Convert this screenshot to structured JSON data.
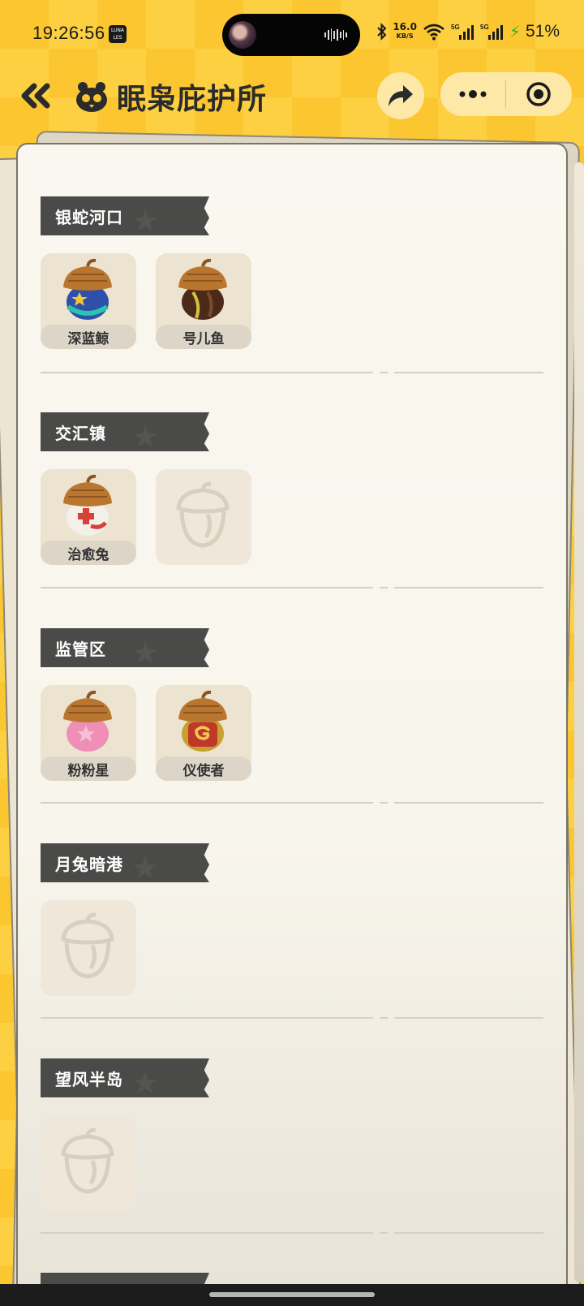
{
  "status_bar": {
    "time": "19:26:56",
    "badge": "LUNA LES",
    "net_speed": "16.0",
    "net_unit": "KB/S",
    "battery": "51%"
  },
  "header": {
    "title": "眠枭庇护所"
  },
  "sections": [
    {
      "title": "银蛇河口",
      "items": [
        {
          "name": "深蓝鲸",
          "icon": "acorn-blue-icon",
          "collected": true
        },
        {
          "name": "号儿鱼",
          "icon": "acorn-brown-icon",
          "collected": true
        }
      ]
    },
    {
      "title": "交汇镇",
      "items": [
        {
          "name": "治愈兔",
          "icon": "acorn-red-cross-icon",
          "collected": true
        },
        {
          "name": "",
          "icon": "acorn-empty-icon",
          "collected": false
        }
      ]
    },
    {
      "title": "监管区",
      "items": [
        {
          "name": "粉粉星",
          "icon": "acorn-pink-icon",
          "collected": true
        },
        {
          "name": "仪使者",
          "icon": "acorn-gold-icon",
          "collected": true
        }
      ]
    },
    {
      "title": "月兔暗港",
      "items": [
        {
          "name": "",
          "icon": "acorn-empty-icon",
          "collected": false
        }
      ]
    },
    {
      "title": "望风半岛",
      "items": [
        {
          "name": "",
          "icon": "acorn-empty-icon",
          "collected": false
        }
      ]
    }
  ],
  "colors": {
    "background": "#fbc62f",
    "paper": "#f9f7ef",
    "label_bg": "#4a4a48"
  }
}
